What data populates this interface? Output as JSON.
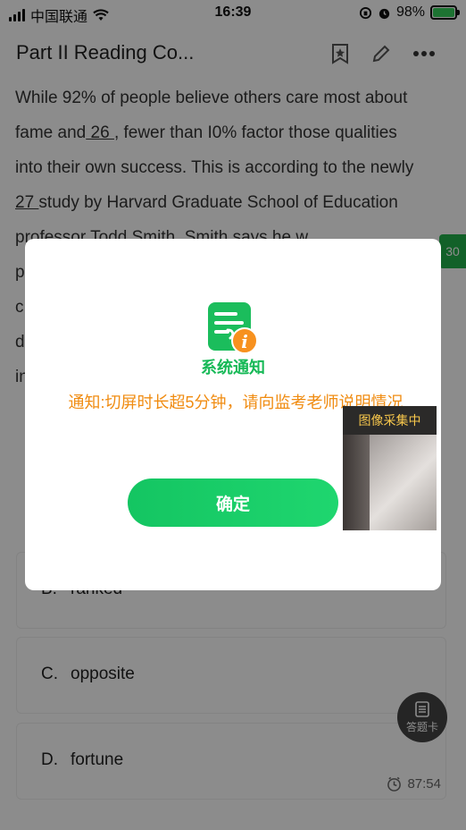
{
  "status_bar": {
    "carrier": "中国联通",
    "time": "16:39",
    "battery": "98%"
  },
  "header": {
    "title": "Part II Reading Co..."
  },
  "passage": {
    "line1": "While 92% of people believe others care most about",
    "line2_pre": "fame and",
    "blank1": " 26 ",
    "line2_post": ", fewer than I0% factor those qualities",
    "line3": "into their own success. This is according to the newly",
    "blank2": "27 ",
    "line4_post": "study by Harvard Graduate School of Education",
    "line5": "professor Todd Smith. Smith says he w",
    "line6": "p",
    "line7": "c",
    "line8": "d",
    "line9": "in"
  },
  "side_tab": {
    "label": "30"
  },
  "options": [
    {
      "letter": "B.",
      "text": "ranked"
    },
    {
      "letter": "C.",
      "text": "opposite"
    },
    {
      "letter": "D.",
      "text": "fortune"
    }
  ],
  "answer_card": {
    "label": "答题卡"
  },
  "timer": {
    "value": "87:54"
  },
  "dialog": {
    "title": "系统通知",
    "message": "通知:切屏时长超5分钟，请向监考老师说明情况",
    "confirm_label": "确定"
  },
  "camera": {
    "label": "图像采集中"
  },
  "colors": {
    "accent_green": "#17b957",
    "notice_orange": "#f08c12"
  }
}
